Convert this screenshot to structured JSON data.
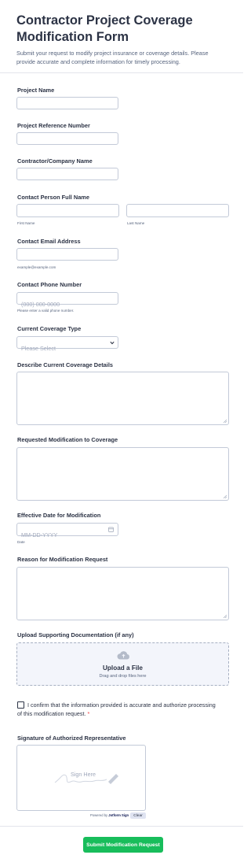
{
  "form": {
    "title": "Contractor Project Coverage Modification Form",
    "subtitle": "Submit your request to modify project insurance or coverage details. Please provide accurate and complete information for timely processing."
  },
  "fields": {
    "project_name": {
      "label": "Project Name",
      "value": ""
    },
    "project_ref": {
      "label": "Project Reference Number",
      "value": ""
    },
    "company": {
      "label": "Contractor/Company Name",
      "value": ""
    },
    "contact_name": {
      "label": "Contact Person Full Name",
      "first_sub": "First Name",
      "last_sub": "Last Name"
    },
    "email": {
      "label": "Contact Email Address",
      "sub": "example@example.com"
    },
    "phone": {
      "label": "Contact Phone Number",
      "placeholder": "(000) 000-0000",
      "sub": "Please enter a valid phone number."
    },
    "coverage_type": {
      "label": "Current Coverage Type",
      "placeholder": "Please Select"
    },
    "current_details": {
      "label": "Describe Current Coverage Details"
    },
    "requested_mod": {
      "label": "Requested Modification to Coverage"
    },
    "effective_date": {
      "label": "Effective Date for Modification",
      "placeholder": "MM-DD-YYYY",
      "sub": "Date"
    },
    "reason": {
      "label": "Reason for Modification Request"
    },
    "upload": {
      "label": "Upload Supporting Documentation (if any)",
      "title": "Upload a File",
      "hint": "Drag and drop files here"
    },
    "confirm": {
      "text": "I confirm that the information provided is accurate and authorize processing of this modification request.",
      "required_mark": "*"
    },
    "signature": {
      "label": "Signature of Authorized Representative",
      "placeholder": "Sign Here",
      "powered_prefix": "Powered by",
      "powered_brand": "Jotform Sign",
      "clear": "Clear"
    }
  },
  "submit": {
    "label": "Submit Modification Request"
  },
  "colors": {
    "accent": "#18bd5b",
    "required": "#f23a3c",
    "border": "#c3cad8",
    "text": "#2c3345"
  }
}
